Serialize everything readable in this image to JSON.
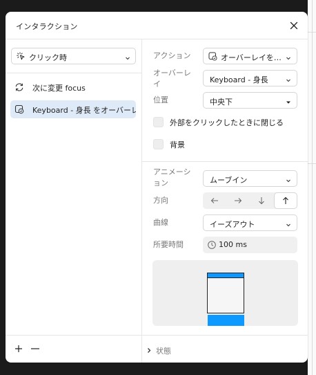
{
  "dialog": {
    "title": "インタラクション"
  },
  "trigger": {
    "label": "クリック時"
  },
  "interactions": [
    {
      "label": "次に変更 focus",
      "icon": "swap-icon",
      "selected": false
    },
    {
      "label": "Keyboard - 身長 をオーバーレ",
      "icon": "overlay-icon",
      "selected": true
    }
  ],
  "properties": {
    "action": {
      "label": "アクション",
      "value": "オーバーレイを…"
    },
    "overlay": {
      "label": "オーバーレイ",
      "value": "Keyboard - 身長"
    },
    "position": {
      "label": "位置",
      "value": "中央下"
    },
    "close_on_outside": {
      "label": "外部をクリックしたときに閉じる",
      "checked": false
    },
    "background": {
      "label": "背景",
      "checked": false
    },
    "animation": {
      "label": "アニメーション",
      "value": "ムーブイン"
    },
    "direction": {
      "label": "方向",
      "options": [
        "←",
        "→",
        "↓",
        "↑"
      ],
      "active": 3
    },
    "curve": {
      "label": "曲線",
      "value": "イーズアウト"
    },
    "duration": {
      "label": "所要時間",
      "value": "100 ms"
    }
  },
  "state": {
    "label": "状態"
  },
  "colors": {
    "accent": "#0d99ff",
    "selected_bg": "#dfeaf8"
  }
}
